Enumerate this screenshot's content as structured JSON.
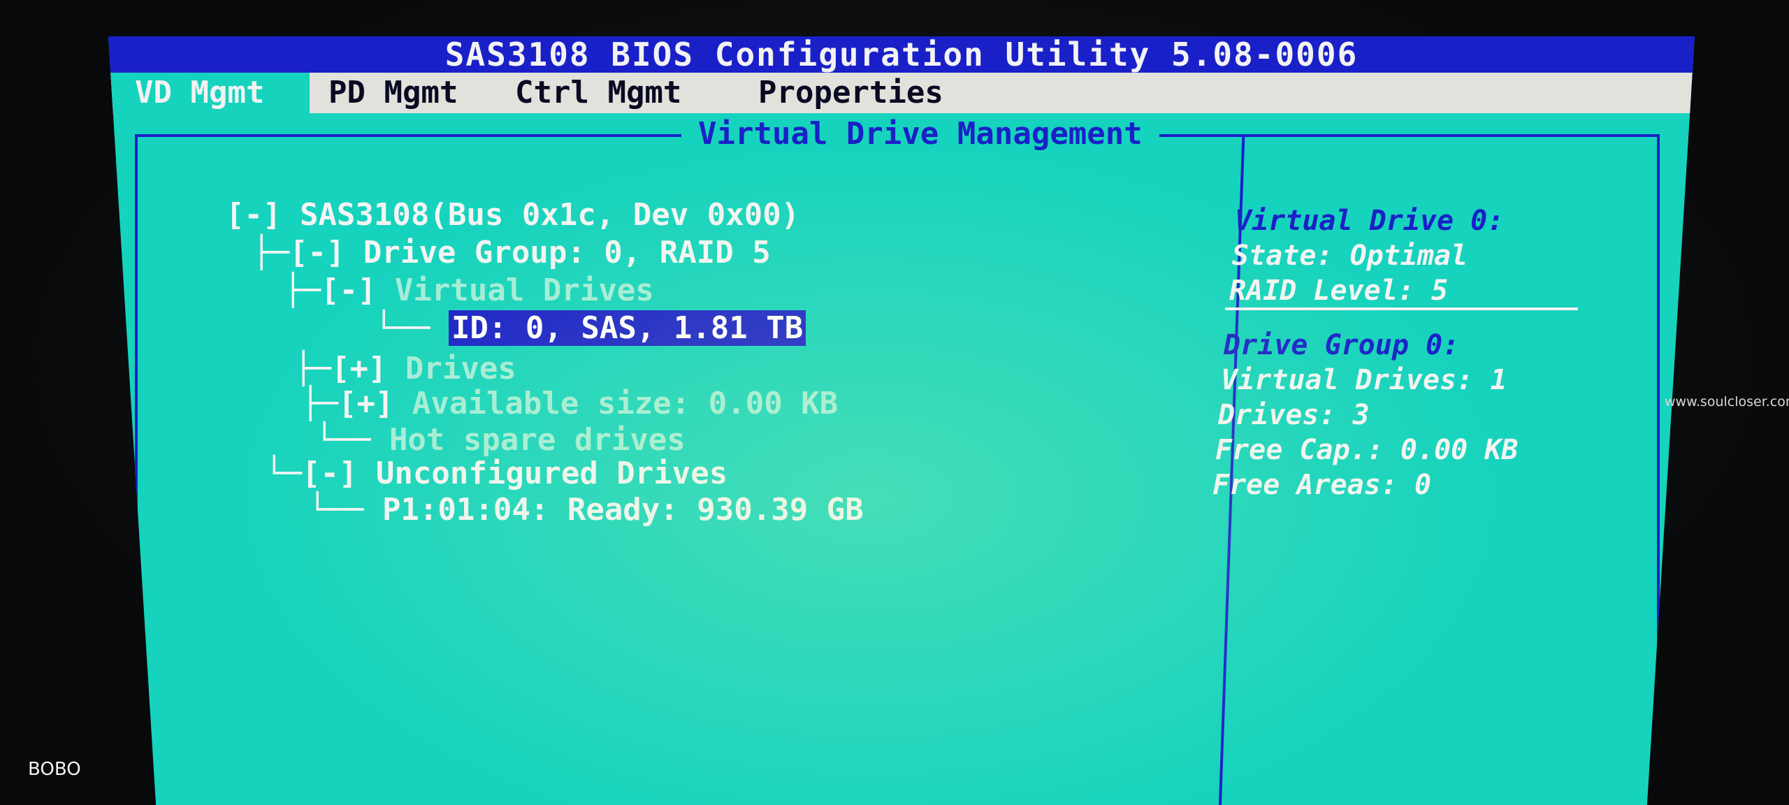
{
  "title_bar": {
    "title": "SAS3108 BIOS Configuration Utility 5.08-0006"
  },
  "menu": {
    "items": [
      {
        "label": "VD Mgmt",
        "active": true
      },
      {
        "label": "PD Mgmt",
        "active": false
      },
      {
        "label": "Ctrl Mgmt",
        "active": false
      },
      {
        "label": "Properties",
        "active": false
      }
    ]
  },
  "panel": {
    "title": "Virtual Drive Management"
  },
  "tree": {
    "controller": {
      "prefix": "[-] ",
      "label": "SAS3108(Bus 0x1c, Dev 0x00)"
    },
    "drive_group": {
      "prefix": "├─[-] ",
      "label": "Drive Group: 0, RAID 5"
    },
    "virtual_drives": {
      "prefix": "├─[-] ",
      "label": "Virtual Drives"
    },
    "vd_item": {
      "prefix": "└── ",
      "label": "ID: 0, SAS, 1.81 TB"
    },
    "drives": {
      "prefix": "├─[+] ",
      "label": "Drives"
    },
    "available": {
      "prefix": "├─[+] ",
      "label": "Available size: 0.00 KB"
    },
    "hot_spare": {
      "prefix": "└── ",
      "label": "Hot spare drives"
    },
    "unconfigured": {
      "prefix": "└─[-] ",
      "label": "Unconfigured Drives"
    },
    "unconfigured_item": {
      "prefix": "└── ",
      "label": "P1:01:04: Ready: 930.39 GB"
    }
  },
  "info": {
    "vd_heading": "Virtual Drive 0:",
    "state": "State: Optimal",
    "raid_level": "RAID Level: 5",
    "dg_heading": "Drive Group 0:",
    "virtual_drives": "Virtual Drives: 1",
    "drives": "Drives: 3",
    "free_cap": "Free Cap.: 0.00 KB",
    "free_areas": "Free Areas: 0"
  },
  "watermark": "www.soulcloser.com",
  "signature": "BOBO",
  "colors": {
    "screen_bg": "#16d3bd",
    "title_bg": "#1a20c8",
    "selection_bg": "#1a20c8",
    "menu_bg": "#e2e2dc"
  }
}
